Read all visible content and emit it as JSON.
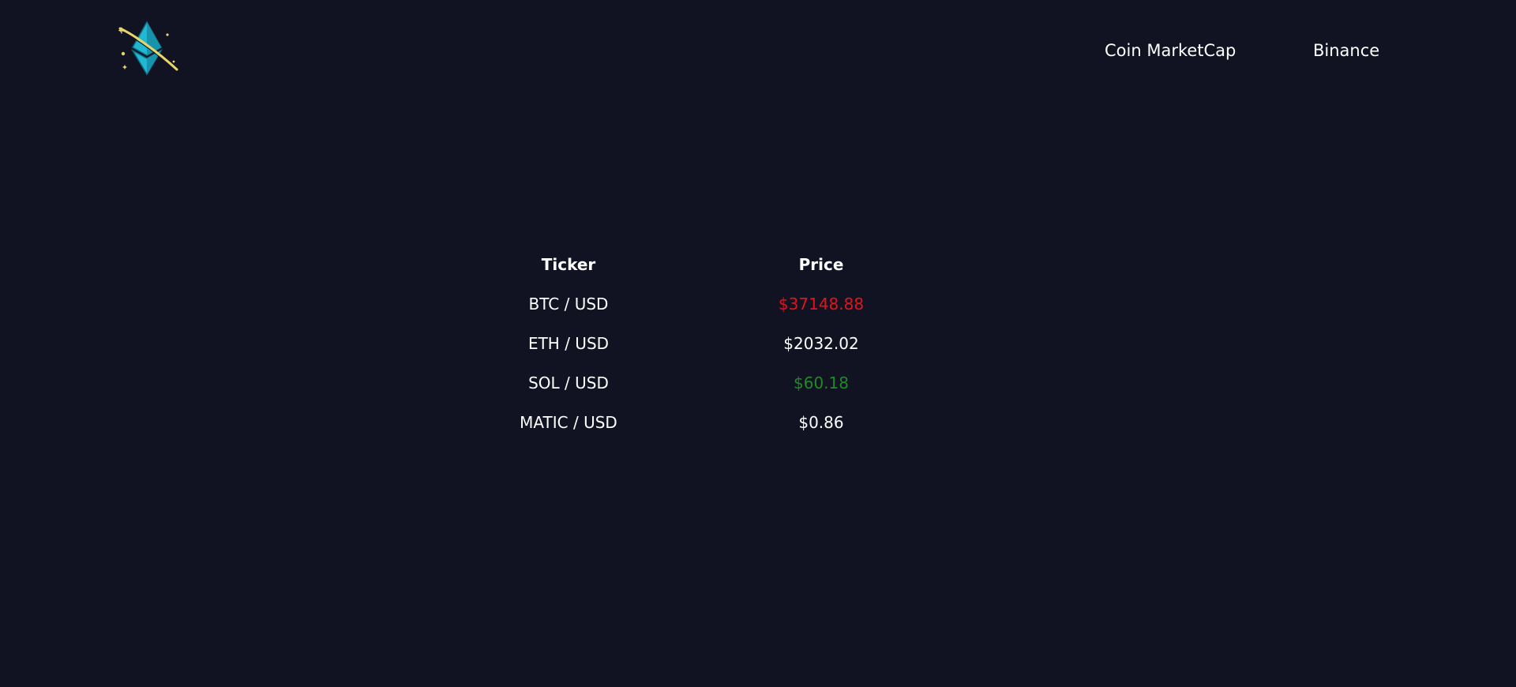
{
  "logo": {
    "icon": "ethereum-planet-icon",
    "colors": {
      "diamond": "#1fb6cf",
      "ring": "#e8d56a"
    }
  },
  "nav": {
    "links": [
      {
        "label": "Coin MarketCap"
      },
      {
        "label": "Binance"
      }
    ]
  },
  "table": {
    "headers": {
      "ticker": "Ticker",
      "price": "Price"
    },
    "rows": [
      {
        "ticker": "BTC / USD",
        "price": "$37148.88",
        "color": "#e0141c"
      },
      {
        "ticker": "ETH / USD",
        "price": "$2032.02",
        "color": "#ffffff"
      },
      {
        "ticker": "SOL / USD",
        "price": "$60.18",
        "color": "#1f8a25"
      },
      {
        "ticker": "MATIC / USD",
        "price": "$0.86",
        "color": "#ffffff"
      }
    ]
  }
}
